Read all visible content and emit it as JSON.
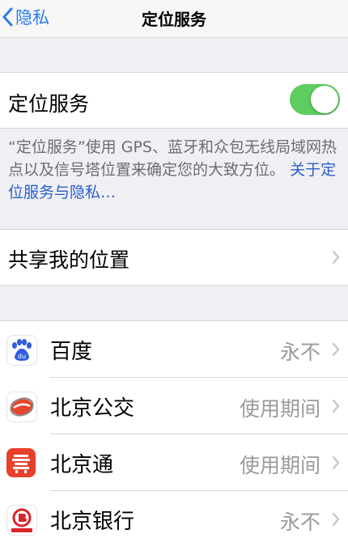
{
  "nav": {
    "back_label": "隐私",
    "title": "定位服务"
  },
  "location_services": {
    "label": "定位服务",
    "enabled": true,
    "description_text": "“定位服务”使用 GPS、蓝牙和众包无线局域网热点以及信号塔位置来确定您的大致方位。",
    "description_link": "关于定位服务与隐私…"
  },
  "share_location": {
    "label": "共享我的位置"
  },
  "apps": [
    {
      "name": "百度",
      "status": "永不",
      "icon": "baidu-icon"
    },
    {
      "name": "北京公交",
      "status": "使用期间",
      "icon": "beijing-bus-icon"
    },
    {
      "name": "北京通",
      "status": "使用期间",
      "icon": "beijingtong-icon"
    },
    {
      "name": "北京银行",
      "status": "永不",
      "icon": "bank-of-beijing-icon"
    }
  ],
  "colors": {
    "accent": "#2a7bf6",
    "toggle_on": "#5ccd5e",
    "background": "#efeff4"
  }
}
